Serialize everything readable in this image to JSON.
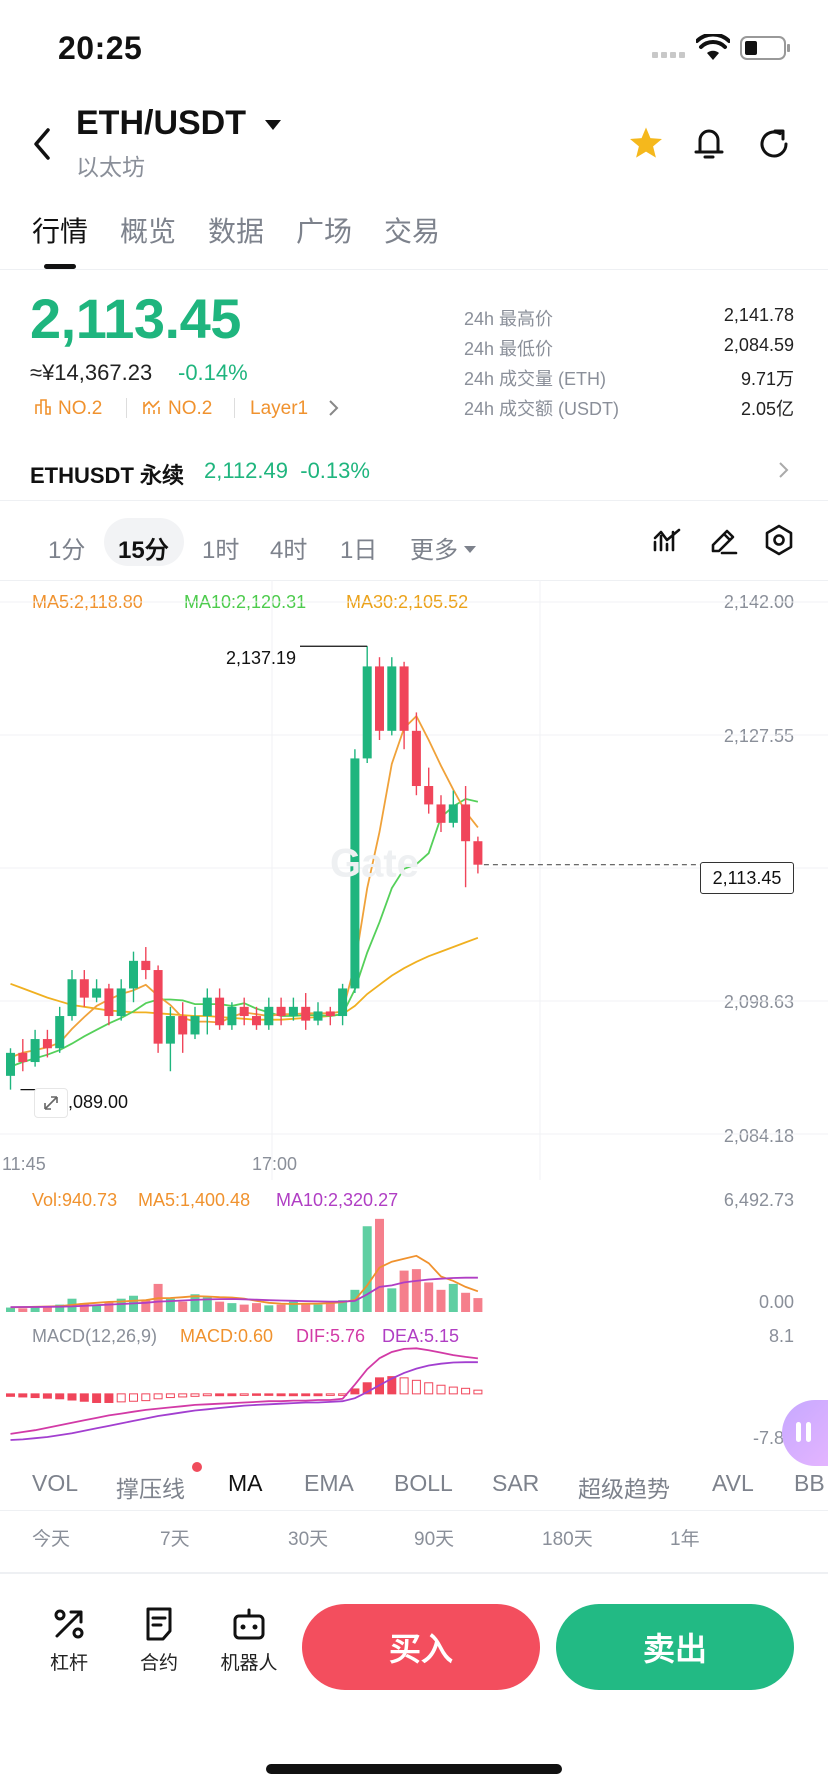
{
  "status_bar": {
    "time": "20:25"
  },
  "header": {
    "pair": "ETH/USDT",
    "name": "以太坊"
  },
  "tabs": [
    "行情",
    "概览",
    "数据",
    "广场",
    "交易"
  ],
  "price": {
    "last": "2,113.45",
    "cny": "≈¥14,367.23",
    "change": "-0.14%",
    "tags": [
      "NO.2",
      "NO.2",
      "Layer1"
    ]
  },
  "stats": [
    {
      "label": "24h 最高价",
      "value": "2,141.78"
    },
    {
      "label": "24h 最低价",
      "value": "2,084.59"
    },
    {
      "label": "24h 成交量 (ETH)",
      "value": "9.71万"
    },
    {
      "label": "24h 成交额 (USDT)",
      "value": "2.05亿"
    }
  ],
  "perpetual": {
    "label": "ETHUSDT 永续",
    "price": "2,112.49",
    "change": "-0.13%"
  },
  "intervals": [
    "1分",
    "15分",
    "1时",
    "4时",
    "1日",
    "更多"
  ],
  "active_interval": "15分",
  "chart_data": {
    "type": "candlestick",
    "ma_legend": {
      "ma5": "MA5:2,118.80",
      "ma10": "MA10:2,120.31",
      "ma30": "MA30:2,105.52"
    },
    "y_axis": [
      "2,142.00",
      "2,127.55",
      "2,113.45",
      "2,098.63",
      "2,084.18"
    ],
    "ylim": [
      2084.18,
      2142.0
    ],
    "x_labels": [
      "11:45",
      "17:00"
    ],
    "high_label": "2,137.19",
    "low_label": "2,089.00",
    "current_price": "2,113.45",
    "colors": {
      "up": "#1fb57e",
      "down": "#f0455a",
      "ma5": "#f0a23a",
      "ma10": "#55d05a",
      "ma30": "#f0b020"
    },
    "candles": [
      [
        2090.5,
        2093.0,
        2089.0,
        2093.5
      ],
      [
        2093.0,
        2092.0,
        2091.0,
        2094.5
      ],
      [
        2092.0,
        2094.5,
        2091.5,
        2095.5
      ],
      [
        2094.5,
        2093.5,
        2092.5,
        2095.5
      ],
      [
        2093.5,
        2097.0,
        2093.0,
        2098.0
      ],
      [
        2097.0,
        2101.0,
        2096.5,
        2102.0
      ],
      [
        2101.0,
        2099.0,
        2098.0,
        2102.0
      ],
      [
        2099.0,
        2100.0,
        2098.5,
        2101.0
      ],
      [
        2100.0,
        2097.0,
        2096.0,
        2100.5
      ],
      [
        2097.0,
        2100.0,
        2096.5,
        2101.0
      ],
      [
        2100.0,
        2103.0,
        2098.5,
        2104.0
      ],
      [
        2103.0,
        2102.0,
        2101.0,
        2104.5
      ],
      [
        2102.0,
        2094.0,
        2093.0,
        2102.5
      ],
      [
        2094.0,
        2097.0,
        2091.0,
        2098.0
      ],
      [
        2097.0,
        2095.0,
        2093.0,
        2098.5
      ],
      [
        2095.0,
        2097.0,
        2094.5,
        2098.0
      ],
      [
        2097.0,
        2099.0,
        2095.0,
        2100.0
      ],
      [
        2099.0,
        2096.0,
        2095.5,
        2100.0
      ],
      [
        2096.0,
        2098.0,
        2095.5,
        2098.5
      ],
      [
        2098.0,
        2097.0,
        2096.0,
        2099.0
      ],
      [
        2097.0,
        2096.0,
        2095.5,
        2098.0
      ],
      [
        2096.0,
        2098.0,
        2095.5,
        2099.0
      ],
      [
        2098.0,
        2097.0,
        2096.0,
        2099.0
      ],
      [
        2097.0,
        2098.0,
        2096.5,
        2099.0
      ],
      [
        2098.0,
        2096.5,
        2095.5,
        2099.5
      ],
      [
        2096.5,
        2097.5,
        2096.0,
        2098.5
      ],
      [
        2097.5,
        2097.0,
        2096.0,
        2098.0
      ],
      [
        2097.0,
        2100.0,
        2096.0,
        2100.5
      ],
      [
        2100.0,
        2125.0,
        2099.5,
        2126.0
      ],
      [
        2125.0,
        2135.0,
        2124.5,
        2137.19
      ],
      [
        2135.0,
        2128.0,
        2127.0,
        2136.0
      ],
      [
        2128.0,
        2135.0,
        2127.5,
        2136.0
      ],
      [
        2135.0,
        2128.0,
        2126.0,
        2135.5
      ],
      [
        2128.0,
        2122.0,
        2121.0,
        2130.0
      ],
      [
        2122.0,
        2120.0,
        2119.0,
        2124.0
      ],
      [
        2120.0,
        2118.0,
        2117.0,
        2121.0
      ],
      [
        2118.0,
        2120.0,
        2117.5,
        2121.5
      ],
      [
        2120.0,
        2116.0,
        2111.0,
        2122.0
      ],
      [
        2116.0,
        2113.45,
        2112.5,
        2116.5
      ]
    ],
    "ma5": [
      2092.5,
      2093.0,
      2093.3,
      2093.6,
      2094.1,
      2095.6,
      2096.9,
      2098.1,
      2098.8,
      2099.4,
      2099.8,
      2100.4,
      2099.2,
      2098.2,
      2096.8,
      2096.4,
      2096.4,
      2096.3,
      2096.9,
      2097.4,
      2097.2,
      2097.0,
      2097.2,
      2097.2,
      2097.3,
      2097.3,
      2097.3,
      2097.5,
      2102.6,
      2110.9,
      2117.0,
      2124.4,
      2128.3,
      2129.6,
      2127.0,
      2124.2,
      2121.6,
      2119.2,
      2117.5
    ],
    "ma10": [
      2091.5,
      2092.0,
      2092.4,
      2092.8,
      2093.3,
      2094.0,
      2094.8,
      2095.5,
      2096.2,
      2096.8,
      2097.5,
      2098.4,
      2098.8,
      2098.8,
      2098.7,
      2098.3,
      2098.3,
      2098.3,
      2098.1,
      2098.4,
      2097.8,
      2097.4,
      2097.0,
      2097.0,
      2097.1,
      2097.1,
      2097.0,
      2097.2,
      2099.9,
      2103.9,
      2107.2,
      2110.9,
      2113.0,
      2113.5,
      2114.7,
      2118.6,
      2119.8,
      2120.6,
      2120.3
    ],
    "ma30": [
      2100.5,
      2100.0,
      2099.5,
      2099.0,
      2098.6,
      2098.2,
      2098.0,
      2097.8,
      2097.6,
      2097.5,
      2097.4,
      2097.4,
      2097.3,
      2097.2,
      2097.1,
      2097.0,
      2097.0,
      2096.9,
      2096.8,
      2096.7,
      2096.6,
      2096.6,
      2096.6,
      2096.7,
      2096.8,
      2096.9,
      2097.0,
      2097.2,
      2098.1,
      2099.4,
      2100.4,
      2101.4,
      2102.2,
      2102.9,
      2103.5,
      2104.0,
      2104.5,
      2105.0,
      2105.5
    ]
  },
  "volume": {
    "vol": "Vol:940.73",
    "ma5": "MA5:1,400.48",
    "ma10": "MA10:2,320.27",
    "axis_top": "6,492.73",
    "axis_bottom": "0.00",
    "values": [
      300,
      250,
      400,
      350,
      500,
      900,
      600,
      450,
      700,
      900,
      1100,
      800,
      1900,
      900,
      700,
      1200,
      1000,
      700,
      600,
      500,
      600,
      450,
      500,
      700,
      600,
      500,
      700,
      800,
      1500,
      5800,
      6300,
      1600,
      2800,
      2900,
      2000,
      1500,
      1900,
      1300,
      940.73
    ],
    "ma5_line": [
      320,
      330,
      350,
      370,
      400,
      480,
      560,
      620,
      680,
      710,
      760,
      800,
      930,
      950,
      1000,
      1070,
      1050,
      1000,
      980,
      900,
      750,
      620,
      570,
      540,
      560,
      560,
      600,
      660,
      820,
      1800,
      3000,
      3400,
      3600,
      3800,
      3300,
      2400,
      2100,
      1700,
      1400
    ],
    "ma10_line": [
      330,
      335,
      340,
      350,
      360,
      380,
      420,
      460,
      500,
      540,
      580,
      620,
      700,
      740,
      780,
      820,
      850,
      870,
      880,
      860,
      830,
      800,
      780,
      760,
      740,
      720,
      700,
      700,
      750,
      1200,
      1700,
      1800,
      2000,
      2100,
      2200,
      2250,
      2300,
      2320,
      2320
    ]
  },
  "macd": {
    "params": "MACD(12,26,9)",
    "macd": "MACD:0.60",
    "dif": "DIF:5.76",
    "dea": "DEA:5.15",
    "axis_top": "8.1",
    "axis_bottom": "-7.82",
    "hist": [
      -0.4,
      -0.5,
      -0.6,
      -0.7,
      -0.8,
      -1.0,
      -1.2,
      -1.4,
      -1.4,
      -1.3,
      -1.2,
      -1.1,
      -0.8,
      -0.6,
      -0.5,
      -0.4,
      -0.3,
      -0.3,
      -0.3,
      -0.2,
      -0.2,
      -0.2,
      -0.3,
      -0.3,
      -0.3,
      -0.3,
      -0.2,
      -0.1,
      0.8,
      1.8,
      2.6,
      2.8,
      2.6,
      2.2,
      1.8,
      1.4,
      1.1,
      0.9,
      0.6
    ],
    "dif_line": [
      -6.5,
      -6.2,
      -5.9,
      -5.5,
      -5.1,
      -4.7,
      -4.3,
      -3.9,
      -3.5,
      -3.2,
      -2.9,
      -2.6,
      -2.4,
      -2.2,
      -2.0,
      -1.8,
      -1.7,
      -1.6,
      -1.5,
      -1.4,
      -1.3,
      -1.2,
      -1.2,
      -1.1,
      -1.1,
      -1.0,
      -1.0,
      -0.8,
      1.5,
      4.0,
      5.8,
      6.8,
      7.3,
      7.4,
      7.1,
      6.7,
      6.3,
      6.0,
      5.76
    ],
    "dea_line": [
      -7.5,
      -7.4,
      -7.2,
      -7.0,
      -6.7,
      -6.4,
      -6.0,
      -5.6,
      -5.2,
      -4.8,
      -4.4,
      -4.0,
      -3.6,
      -3.3,
      -3.0,
      -2.7,
      -2.5,
      -2.3,
      -2.1,
      -1.9,
      -1.8,
      -1.7,
      -1.6,
      -1.5,
      -1.4,
      -1.4,
      -1.3,
      -1.2,
      -0.7,
      0.3,
      1.4,
      2.5,
      3.4,
      4.1,
      4.6,
      4.9,
      5.1,
      5.15,
      5.15
    ]
  },
  "indicators": [
    "VOL",
    "撑压线",
    "MA",
    "EMA",
    "BOLL",
    "SAR",
    "超级趋势",
    "AVL",
    "BB"
  ],
  "active_indicator": "MA",
  "performance": [
    "今天",
    "7天",
    "30天",
    "90天",
    "180天",
    "1年"
  ],
  "bottom": {
    "leverage": "杠杆",
    "contract": "合约",
    "bot": "机器人",
    "buy": "买入",
    "sell": "卖出"
  }
}
